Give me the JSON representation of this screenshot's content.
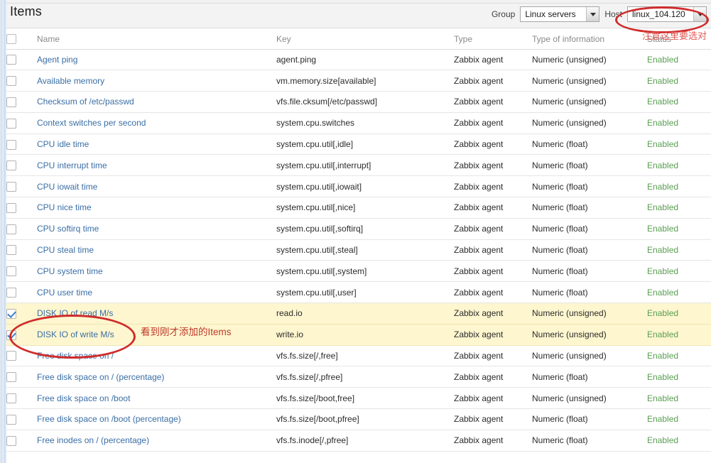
{
  "header": {
    "title": "Items"
  },
  "filters": {
    "group_label": "Group",
    "group_value": "Linux servers",
    "host_label": "Host",
    "host_value": "linux_104.120"
  },
  "annotations": {
    "host_note": "注意这里要选对",
    "items_note": "看到刚才添加的Items"
  },
  "colors": {
    "link": "#3a6ea5",
    "status_enabled": "#5a9e52",
    "highlight_row": "#fdf6cf",
    "annotation_red": "#d02b2b"
  },
  "table": {
    "columns": [
      "",
      "Name",
      "Key",
      "Type",
      "Type of information",
      "Status"
    ],
    "rows": [
      {
        "checked": false,
        "highlight": false,
        "name": "Agent ping",
        "key": "agent.ping",
        "type": "Zabbix agent",
        "toi": "Numeric (unsigned)",
        "status": "Enabled"
      },
      {
        "checked": false,
        "highlight": false,
        "name": "Available memory",
        "key": "vm.memory.size[available]",
        "type": "Zabbix agent",
        "toi": "Numeric (unsigned)",
        "status": "Enabled"
      },
      {
        "checked": false,
        "highlight": false,
        "name": "Checksum of /etc/passwd",
        "key": "vfs.file.cksum[/etc/passwd]",
        "type": "Zabbix agent",
        "toi": "Numeric (unsigned)",
        "status": "Enabled"
      },
      {
        "checked": false,
        "highlight": false,
        "name": "Context switches per second",
        "key": "system.cpu.switches",
        "type": "Zabbix agent",
        "toi": "Numeric (unsigned)",
        "status": "Enabled"
      },
      {
        "checked": false,
        "highlight": false,
        "name": "CPU idle time",
        "key": "system.cpu.util[,idle]",
        "type": "Zabbix agent",
        "toi": "Numeric (float)",
        "status": "Enabled"
      },
      {
        "checked": false,
        "highlight": false,
        "name": "CPU interrupt time",
        "key": "system.cpu.util[,interrupt]",
        "type": "Zabbix agent",
        "toi": "Numeric (float)",
        "status": "Enabled"
      },
      {
        "checked": false,
        "highlight": false,
        "name": "CPU iowait time",
        "key": "system.cpu.util[,iowait]",
        "type": "Zabbix agent",
        "toi": "Numeric (float)",
        "status": "Enabled"
      },
      {
        "checked": false,
        "highlight": false,
        "name": "CPU nice time",
        "key": "system.cpu.util[,nice]",
        "type": "Zabbix agent",
        "toi": "Numeric (float)",
        "status": "Enabled"
      },
      {
        "checked": false,
        "highlight": false,
        "name": "CPU softirq time",
        "key": "system.cpu.util[,softirq]",
        "type": "Zabbix agent",
        "toi": "Numeric (float)",
        "status": "Enabled"
      },
      {
        "checked": false,
        "highlight": false,
        "name": "CPU steal time",
        "key": "system.cpu.util[,steal]",
        "type": "Zabbix agent",
        "toi": "Numeric (float)",
        "status": "Enabled"
      },
      {
        "checked": false,
        "highlight": false,
        "name": "CPU system time",
        "key": "system.cpu.util[,system]",
        "type": "Zabbix agent",
        "toi": "Numeric (float)",
        "status": "Enabled"
      },
      {
        "checked": false,
        "highlight": false,
        "name": "CPU user time",
        "key": "system.cpu.util[,user]",
        "type": "Zabbix agent",
        "toi": "Numeric (float)",
        "status": "Enabled"
      },
      {
        "checked": true,
        "highlight": true,
        "name": "DISK IO of read M/s",
        "key": "read.io",
        "type": "Zabbix agent",
        "toi": "Numeric (unsigned)",
        "status": "Enabled"
      },
      {
        "checked": true,
        "highlight": true,
        "name": "DISK IO of write M/s",
        "key": "write.io",
        "type": "Zabbix agent",
        "toi": "Numeric (unsigned)",
        "status": "Enabled"
      },
      {
        "checked": false,
        "highlight": false,
        "name": "Free disk space on /",
        "key": "vfs.fs.size[/,free]",
        "type": "Zabbix agent",
        "toi": "Numeric (unsigned)",
        "status": "Enabled"
      },
      {
        "checked": false,
        "highlight": false,
        "name": "Free disk space on / (percentage)",
        "key": "vfs.fs.size[/,pfree]",
        "type": "Zabbix agent",
        "toi": "Numeric (float)",
        "status": "Enabled"
      },
      {
        "checked": false,
        "highlight": false,
        "name": "Free disk space on /boot",
        "key": "vfs.fs.size[/boot,free]",
        "type": "Zabbix agent",
        "toi": "Numeric (unsigned)",
        "status": "Enabled"
      },
      {
        "checked": false,
        "highlight": false,
        "name": "Free disk space on /boot (percentage)",
        "key": "vfs.fs.size[/boot,pfree]",
        "type": "Zabbix agent",
        "toi": "Numeric (float)",
        "status": "Enabled"
      },
      {
        "checked": false,
        "highlight": false,
        "name": "Free inodes on / (percentage)",
        "key": "vfs.fs.inode[/,pfree]",
        "type": "Zabbix agent",
        "toi": "Numeric (float)",
        "status": "Enabled"
      }
    ]
  }
}
